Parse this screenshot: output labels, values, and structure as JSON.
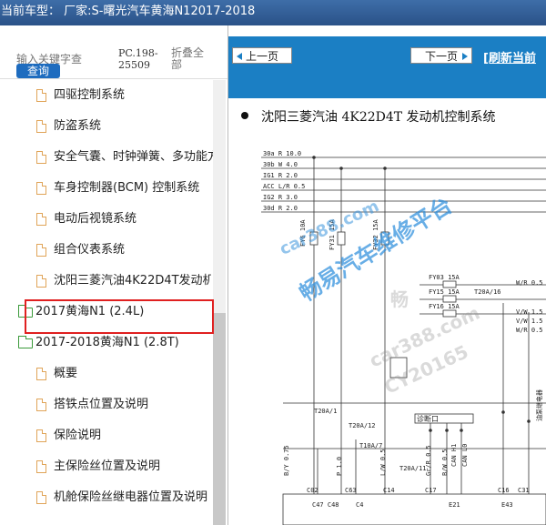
{
  "window": {
    "title": "当前车型：  厂家:S-曙光汽车黄海N12017-2018"
  },
  "search": {
    "placeholder": "输入关键字查",
    "button": "查询",
    "code": "PC.198-25509",
    "fold": "折叠全部"
  },
  "tree": {
    "items": [
      {
        "label": "四驱控制系统",
        "type": "file"
      },
      {
        "label": "防盗系统",
        "type": "file"
      },
      {
        "label": "安全气囊、时钟弹簧、多功能方",
        "type": "file"
      },
      {
        "label": "车身控制器(BCM) 控制系统",
        "type": "file"
      },
      {
        "label": "电动后视镜系统",
        "type": "file"
      },
      {
        "label": "组合仪表系统",
        "type": "file"
      },
      {
        "label": "沈阳三菱汽油4K22D4T发动机控",
        "type": "file",
        "selected": true
      },
      {
        "label": "2017黄海N1 (2.4L)",
        "type": "folder"
      },
      {
        "label": "2017-2018黄海N1 (2.8T)",
        "type": "folder"
      },
      {
        "label": "概要",
        "type": "file"
      },
      {
        "label": "搭铁点位置及说明",
        "type": "file"
      },
      {
        "label": "保险说明",
        "type": "file"
      },
      {
        "label": "主保险丝位置及说明",
        "type": "file"
      },
      {
        "label": "机舱保险丝继电器位置及说明",
        "type": "file"
      }
    ]
  },
  "toolbar": {
    "prev": "上一页",
    "next": "下一页",
    "refresh": "[刷新当前"
  },
  "doc": {
    "title": "沈阳三菱汽油 4K22D4T 发动机控制系统",
    "wires": [
      "30a  R 10.0",
      "30b  W 4.0",
      "IG1  R 2.0",
      "ACC L/R 0.5",
      "IG2  R 3.0",
      "30d  R 2.0"
    ],
    "fuses": [
      "FY6 10A",
      "FY31 15A",
      "FY32 15A"
    ],
    "fuses2": [
      "FY03 15A",
      "FY15 15A",
      "FY16 15A"
    ],
    "labels": [
      "T20A/16",
      "W/R 0.5",
      "V/W 1.5",
      "V/W 1.5",
      "W/R 0.5",
      "T20A/1",
      "T20A/12",
      "诊断口",
      "T10A/7",
      "T20A/11",
      "B/Y 0.75",
      "P 1.0",
      "L/W 0.5",
      "Gr/R 0.5",
      "B/W 0.5",
      "CAN H1",
      "CAN L0",
      "油泵继电器",
      "C02",
      "C63",
      "C14",
      "C17",
      "C16",
      "C31",
      "C47 C48",
      "C4",
      "E21",
      "E43"
    ],
    "watermarks": [
      "car388.com",
      "畅易汽车维修平台",
      "畅",
      "car388.com",
      "CY20165"
    ]
  }
}
